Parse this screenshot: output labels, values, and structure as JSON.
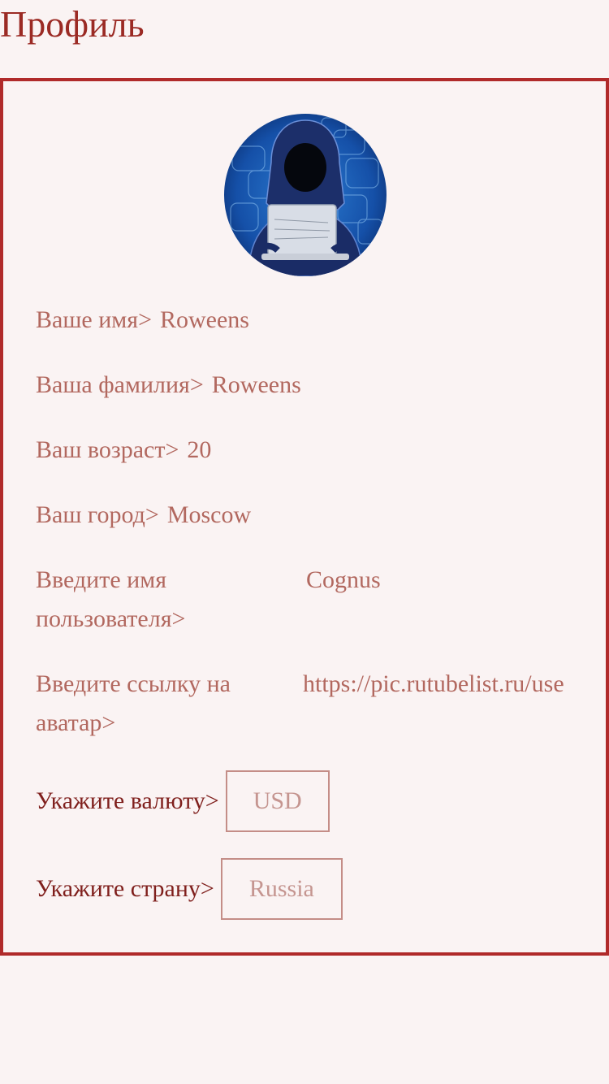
{
  "header": {
    "title": "Профиль"
  },
  "profile": {
    "avatar_icon": "hooded-hacker-avatar",
    "name_label": "Ваше имя>",
    "name_value": "Roweens",
    "surname_label": "Ваша фамилия>",
    "surname_value": "Roweens",
    "age_label": "Ваш возраст>",
    "age_value": "20",
    "city_label": "Ваш город>",
    "city_value": "Moscow",
    "username_label": "Введите имя пользователя>",
    "username_value": "Cognus",
    "avatar_link_label": "Введите ссылку на аватар>",
    "avatar_link_value": "https://pic.rutubelist.ru/use",
    "currency_label": "Укажите валюту>",
    "currency_value": "USD",
    "country_label": "Укажите страну>",
    "country_value": "Russia"
  },
  "colors": {
    "accent": "#9b2a24",
    "border": "#b02a2a",
    "muted_text": "#b2685f",
    "background": "#faf3f3"
  }
}
